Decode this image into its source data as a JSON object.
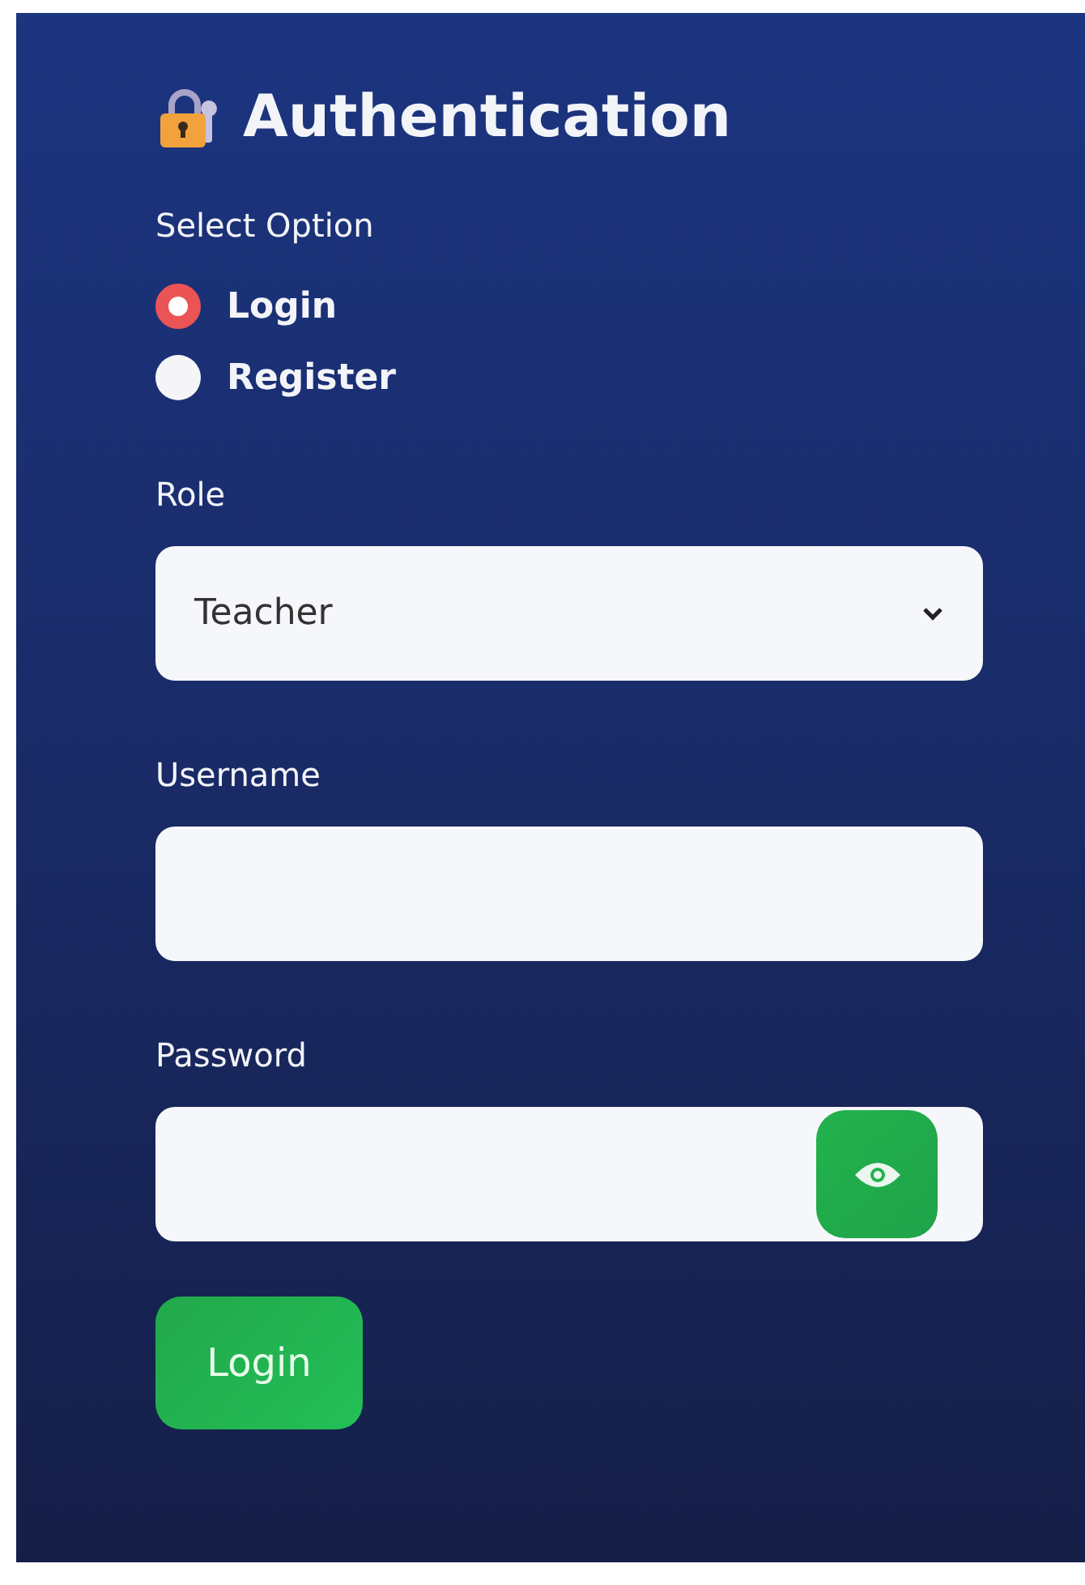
{
  "title": "Authentication",
  "option_group": {
    "label": "Select Option",
    "options": [
      {
        "label": "Login",
        "selected": true
      },
      {
        "label": "Register",
        "selected": false
      }
    ]
  },
  "role": {
    "label": "Role",
    "value": "Teacher"
  },
  "username": {
    "label": "Username"
  },
  "password": {
    "label": "Password"
  },
  "submit": {
    "label": "Login"
  }
}
